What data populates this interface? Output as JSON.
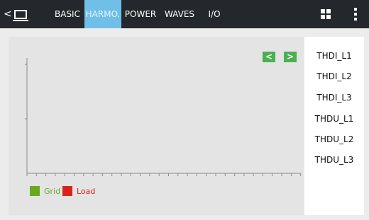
{
  "nav": {
    "tabs": [
      {
        "label": "BASIC",
        "active": false
      },
      {
        "label": "HARMO.",
        "active": true
      },
      {
        "label": "POWER",
        "active": false
      },
      {
        "label": "WAVES",
        "active": false
      },
      {
        "label": "I/O",
        "active": false
      }
    ],
    "back_glyph": "<",
    "icons": [
      "monitor-icon",
      "grid-icon",
      "kebab-menu-icon"
    ]
  },
  "controls": {
    "prev_label": "<",
    "next_label": ">"
  },
  "legend": [
    {
      "label": "Grid",
      "color": "#6aa81e"
    },
    {
      "label": "Load",
      "color": "#d9221c"
    }
  ],
  "sidebar": {
    "items": [
      "THDI_L1",
      "THDI_L2",
      "THDI_L3",
      "THDU_L1",
      "THDU_L2",
      "THDU_L3"
    ]
  },
  "colors": {
    "topbar": "#24282c",
    "active_tab": "#6fbfe8",
    "nav_button": "#4caf50"
  }
}
